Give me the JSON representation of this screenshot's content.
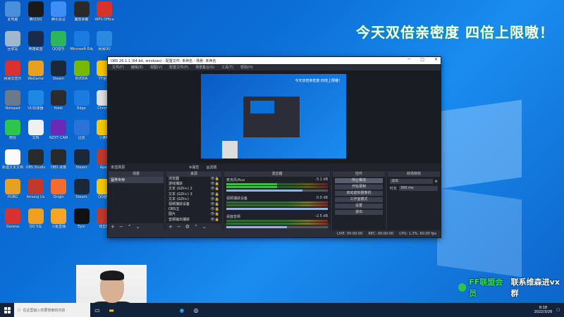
{
  "banner": "今天双倍亲密度 四倍上限嗷！",
  "wechat": {
    "prefix": "FF联盟会员",
    "text": "联系维森进vx群"
  },
  "desktop_icons": [
    {
      "label": "此电脑",
      "color": "#4a90d9"
    },
    {
      "label": "腾讯QQ",
      "color": "#1a1a1a"
    },
    {
      "label": "腾讯会议",
      "color": "#3e8ef7"
    },
    {
      "label": "魔兽争霸",
      "color": "#2a2a2a"
    },
    {
      "label": "WPS Office",
      "color": "#d8332a"
    },
    {
      "label": "回收站",
      "color": "#9fb8d0"
    },
    {
      "label": "英雄联盟",
      "color": "#1a2a4a"
    },
    {
      "label": "QQ音乐",
      "color": "#2db55d"
    },
    {
      "label": "Microsoft Edge",
      "color": "#1c7be0"
    },
    {
      "label": "网易UU",
      "color": "#2a8ae0"
    },
    {
      "label": "网易云音乐",
      "color": "#d9322e"
    },
    {
      "label": "WeGame",
      "color": "#e8a020"
    },
    {
      "label": "Steam",
      "color": "#1b2838"
    },
    {
      "label": "NVIDIA",
      "color": "#76b900"
    },
    {
      "label": "YY语音",
      "color": "#f5c400"
    },
    {
      "label": "Notepad",
      "color": "#6a7a8a"
    },
    {
      "label": "UU加速器",
      "color": "#1e88e5"
    },
    {
      "label": "Kook",
      "color": "#2c2c2c"
    },
    {
      "label": "Edge",
      "color": "#1c7be0"
    },
    {
      "label": "Chrome",
      "color": "#e0e0e0"
    },
    {
      "label": "微信",
      "color": "#2ec64a"
    },
    {
      "label": "文档",
      "color": "#f0f0f0"
    },
    {
      "label": "NZXT CAM",
      "color": "#6a2ab5"
    },
    {
      "label": "迅雷",
      "color": "#2a73d8"
    },
    {
      "label": "小黄鸭",
      "color": "#f7c800"
    },
    {
      "label": "新建文本文档",
      "color": "#fafafa"
    },
    {
      "label": "OBS Studio",
      "color": "#2a2a2a"
    },
    {
      "label": "OBS 录像",
      "color": "#2a2a2a"
    },
    {
      "label": "Steam",
      "color": "#1b2838"
    },
    {
      "label": "Apex",
      "color": "#c0392b"
    },
    {
      "label": "PUBG",
      "color": "#e8a020"
    },
    {
      "label": "Among Us",
      "color": "#c0392b"
    },
    {
      "label": "Origin",
      "color": "#f56c2d"
    },
    {
      "label": "Steam",
      "color": "#1b2838"
    },
    {
      "label": "QQ游戏",
      "color": "#f7c800"
    },
    {
      "label": "Garena",
      "color": "#d9322e"
    },
    {
      "label": "QQ飞车",
      "color": "#f0a020"
    },
    {
      "label": "斗鱼直播",
      "color": "#f5a623"
    },
    {
      "label": "Epic",
      "color": "#111"
    },
    {
      "label": "快剪辑",
      "color": "#c0392b"
    }
  ],
  "obs": {
    "title": "OBS 26.1.1 (64-bit, windows) - 配置文件: 未命名 - 场景: 未命名",
    "menu": [
      "文件(F)",
      "编辑(E)",
      "视图(V)",
      "配置文件(P)",
      "场景集合(S)",
      "工具(T)",
      "帮助(H)"
    ],
    "window_buttons": [
      "─",
      "□",
      "✕"
    ],
    "preview_text": "今天双倍亲密度 四倍上限嗷！",
    "source_bar_left": "未选择源",
    "source_bar_right": [
      "⚙属性",
      "▥滤镜"
    ],
    "docks": {
      "scenes": "场景",
      "sources": "来源",
      "mixer": "混音器",
      "controls": "控件",
      "transitions": "转场特效"
    },
    "scenes": [
      "猛男专用"
    ],
    "sources": [
      "浏览器",
      "游戏捕获",
      "文本 (GDI+) 2",
      "文本 (GDI+) 3",
      "文本 (GDI+)",
      "视频捕获设备",
      "OBS主",
      "图片",
      "音频输出捕获"
    ],
    "mixer": [
      {
        "name": "麦克风/Aux",
        "db": "-3.1 dB"
      },
      {
        "name": "视频捕获设备",
        "db": "0.0 dB"
      },
      {
        "name": "桌面音频",
        "db": "-2.5 dB"
      }
    ],
    "mixer_levels": [
      0.75,
      1.0,
      0.6
    ],
    "controls": [
      "停止推流",
      "开始录制",
      "启动虚拟摄像机",
      "工作室模式",
      "设置",
      "退出"
    ],
    "transition_type": "淡出",
    "duration_label": "时长",
    "duration_value": "300 ms",
    "status": [
      "LIVE: 00:00:00",
      "REC: 00:00:00",
      "CPU: 1.3%, 60.00 fps"
    ]
  },
  "taskbar": {
    "search_placeholder": "在这里输入你要搜索的内容",
    "time": "8:18",
    "date": "2022/3/26"
  }
}
